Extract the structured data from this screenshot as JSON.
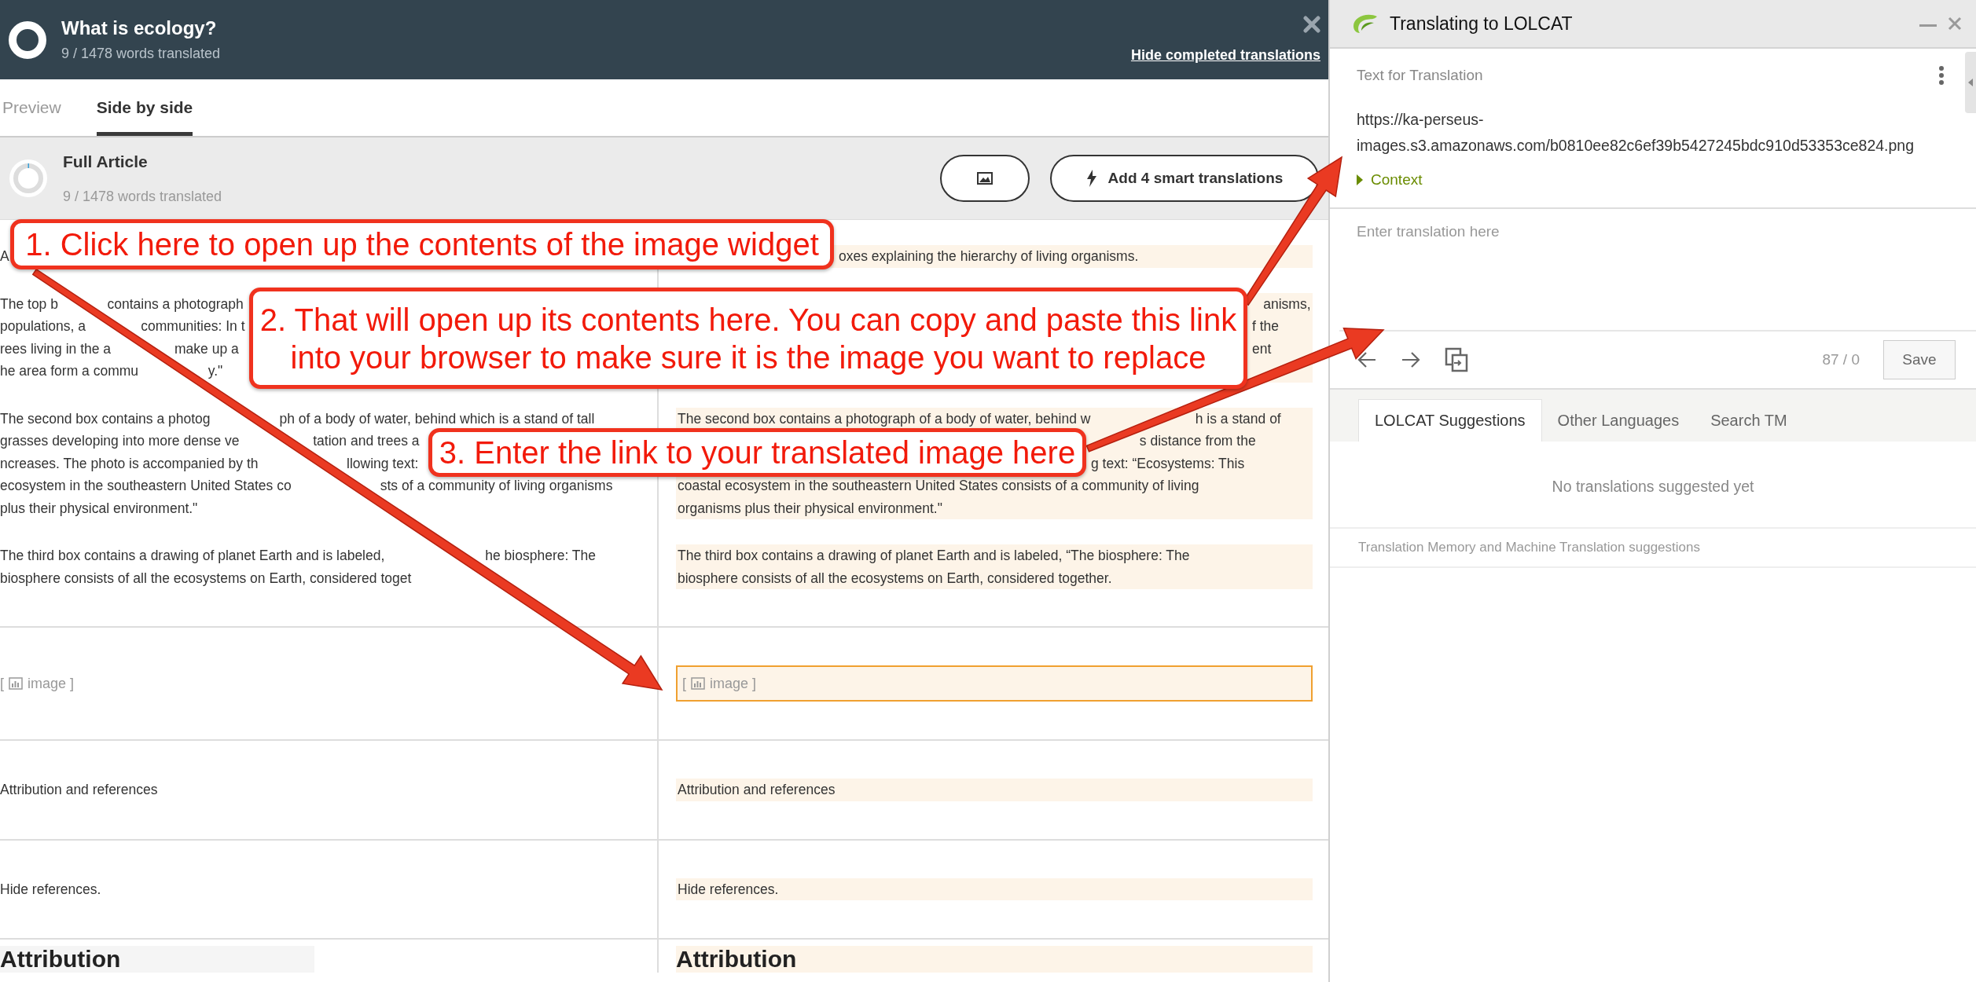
{
  "editor": {
    "title": "What is ecology?",
    "progress": "9 / 1478 words translated",
    "hide_link": "Hide completed translations",
    "tabs": [
      {
        "label": "Preview",
        "selected": false
      },
      {
        "label": "Side by side",
        "selected": true
      }
    ],
    "article": {
      "title": "Full Article",
      "progress": "9 / 1478 words translated",
      "smart_button": "Add 4 smart translations"
    },
    "sections": [
      {
        "rows": [
          {
            "kind": "text",
            "source": {
              "lines": [
                "A"
              ]
            },
            "target": {
              "selected": false,
              "lines": [
                {
                  "text": "oxes explaining the hierarchy of living organisms.",
                  "clipped_start": true
                }
              ]
            }
          },
          {
            "kind": "text",
            "source": {
              "lines": [
                {
                  "parts": [
                    "The top b",
                    "contains a photograph"
                  ]
                },
                {
                  "parts": [
                    "populations, a",
                    "communities: In t"
                  ]
                },
                {
                  "parts": [
                    "rees living in the a",
                    "make up a"
                  ]
                },
                {
                  "parts": [
                    "he area form a commu",
                    "y.\""
                  ]
                }
              ]
            },
            "target": {
              "selected": false,
              "lines": [
                {
                  "text": "anisms,",
                  "clipped_start": true
                },
                {
                  "text": "f the",
                  "clipped_start": true
                },
                {
                  "text": "ent",
                  "clipped_start": true
                }
              ]
            }
          },
          {
            "kind": "text",
            "source": {
              "lines": [
                {
                  "parts": [
                    "The second box contains a photog",
                    "ph of a body of water, behind which is a stand of tall"
                  ]
                },
                {
                  "parts": [
                    "grasses developing into more dense ve",
                    "tation and trees a"
                  ]
                },
                {
                  "parts": [
                    "ncreases. The photo is accompanied by th",
                    "llowing text:"
                  ]
                },
                {
                  "parts": [
                    "ecosystem in the southeastern United States co",
                    "sts of a community of living organisms"
                  ]
                },
                "plus their physical environment.\""
              ]
            },
            "target": {
              "selected": false,
              "lines": [
                {
                  "parts": [
                    "The second box contains a photograph of a body of water, behind w",
                    "h is a stand of"
                  ]
                },
                {
                  "text": "s distance from the",
                  "clipped_start": true
                },
                {
                  "text": "g text: “Ecosystems: This",
                  "clipped_start": true
                },
                "coastal ecosystem in the southeastern United States consists of a community of living",
                "organisms plus their physical environment.\""
              ]
            }
          },
          {
            "kind": "text",
            "source": {
              "lines": [
                {
                  "parts": [
                    "The third box contains a drawing of planet Earth and is labeled,",
                    "he biosphere: The"
                  ]
                },
                "biosphere consists of all the ecosystems on Earth, considered toget"
              ]
            },
            "target": {
              "selected": false,
              "lines": [
                "The third box contains a drawing of planet Earth and is labeled, “The biosphere: The",
                "biosphere consists of all the ecosystems on Earth, considered together."
              ]
            }
          }
        ]
      },
      {
        "rows": [
          {
            "kind": "image",
            "source": {
              "open": "[",
              "label": "image ]"
            },
            "target": {
              "selected": true,
              "open": "[",
              "label": "image ]"
            }
          }
        ]
      },
      {
        "rows": [
          {
            "kind": "text",
            "source": {
              "lines": [
                "Attribution and references"
              ]
            },
            "target": {
              "selected": false,
              "lines": [
                "Attribution and references"
              ]
            }
          }
        ]
      },
      {
        "rows": [
          {
            "kind": "text",
            "source": {
              "lines": [
                "Hide references."
              ]
            },
            "target": {
              "selected": false,
              "lines": [
                "Hide references."
              ]
            }
          }
        ]
      },
      {
        "rows": [
          {
            "kind": "heading",
            "source": {
              "lines": [
                "Attribution"
              ]
            },
            "target": {
              "selected": false,
              "lines": [
                "Attribution"
              ]
            }
          }
        ]
      }
    ]
  },
  "panel": {
    "title": "Translating to LOLCAT",
    "source_label": "Text for Translation",
    "source_text": "https://ka-perseus-images.s3.amazonaws.com/b0810ee82c6ef39b5427245bdc910d53353ce824.png",
    "context": "Context",
    "translation": {
      "placeholder": "Enter translation here"
    },
    "counter": "87 / 0",
    "save": "Save",
    "tabs": [
      {
        "label": "LOLCAT Suggestions",
        "selected": true
      },
      {
        "label": "Other Languages",
        "selected": false
      },
      {
        "label": "Search TM",
        "selected": false
      }
    ],
    "empty_message": "No translations suggested yet",
    "footer": "Translation Memory and Machine Translation suggestions"
  },
  "callouts": [
    {
      "text": "1. Click here to open up the contents of the image widget"
    },
    {
      "text": "2. That will open up its contents here. You can copy and paste this link into your browser to make sure it is the image you want to replace"
    },
    {
      "text": "3. Enter the link to your translated image here"
    }
  ]
}
